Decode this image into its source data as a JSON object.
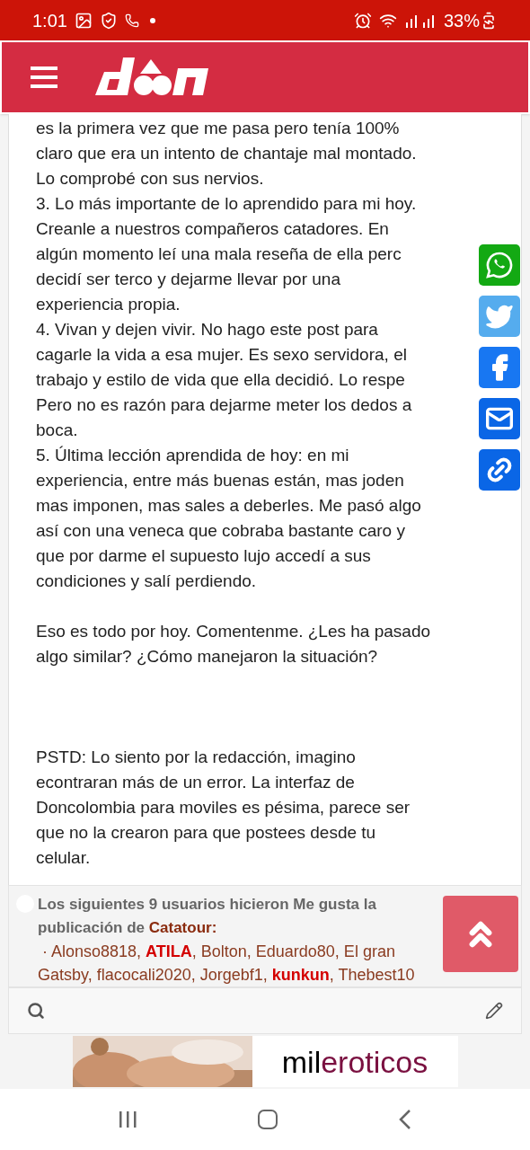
{
  "status_bar": {
    "time": "1:01",
    "battery": "33%"
  },
  "post": {
    "paragraphs": [
      {
        "lines": [
          "es la primera vez que me pasa pero tenía 100%",
          "claro que era un intento de chantaje mal montado.",
          "Lo comprobé con sus nervios.",
          "3. Lo más importante de lo aprendido para mi hoy.",
          "Creanle a nuestros compañeros catadores. En",
          "algún momento leí una mala reseña de ella perc",
          "decidí ser terco y dejarme llevar por una",
          "experiencia propia.",
          "4. Vivan y dejen vivir. No hago este post para",
          "cagarle la vida a esa mujer. Es sexo servidora, el",
          "trabajo y estilo de vida que ella decidió. Lo respe",
          "Pero no es razón para dejarme meter los dedos a",
          "boca.",
          "5. Última lección aprendida de hoy: en mi",
          "experiencia, entre más buenas están, mas joden",
          "mas imponen, mas sales a deberles. Me pasó algo",
          "así con una veneca que cobraba bastante caro y",
          "que por darme el supuesto lujo accedí a sus",
          "condiciones y salí perdiendo."
        ]
      },
      {
        "lines": [
          "Eso es todo por hoy. Comentenme. ¿Les ha pasado",
          "algo similar? ¿Cómo manejaron la situación?"
        ]
      },
      {
        "lines": [
          "PSTD: Lo siento por la redacción, imagino",
          "econtraran más de un error. La interfaz de",
          "Doncolombia para moviles es pésima, parece ser",
          "que no la crearon para que postees desde tu",
          "celular."
        ]
      }
    ]
  },
  "likes": {
    "intro": "Los siguientes 9 usuarios hicieron Me gusta la publicación de",
    "author": "Catatour:",
    "bullet": "·",
    "users": "Alonso8818, **ATILA**, Bolton, Eduardo80, El gran Gatsby, flacocali2020, Jorgebf1, **kunkun**, Thebest10"
  },
  "ad": {
    "brand_start": "mil",
    "brand_end": "eroticos"
  }
}
